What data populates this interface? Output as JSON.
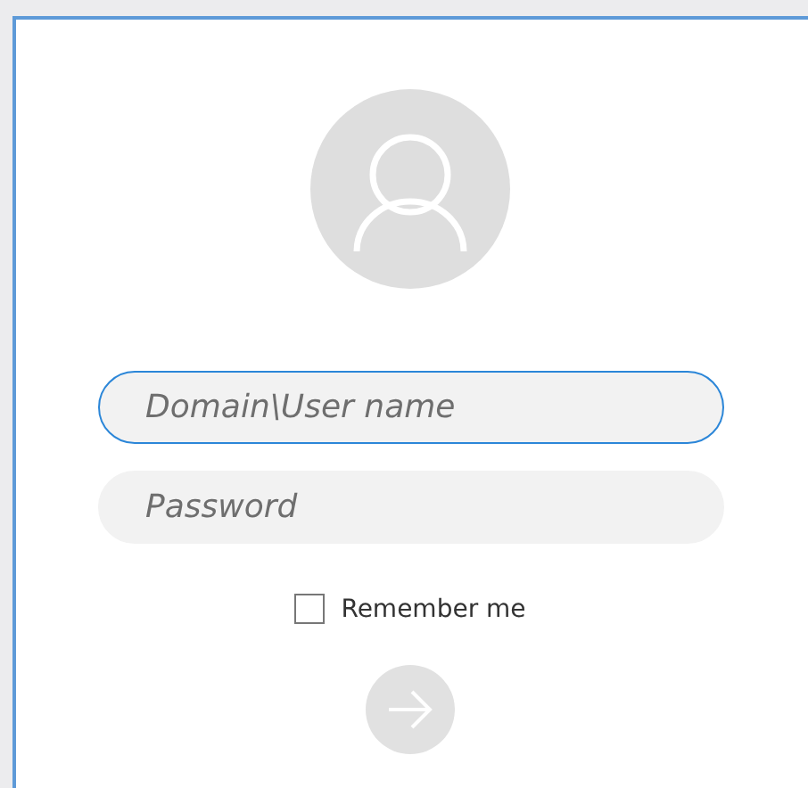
{
  "username": {
    "placeholder": "Domain\\User name",
    "focused": true
  },
  "password": {
    "placeholder": "Password",
    "focused": false
  },
  "remember": {
    "label": "Remember me",
    "checked": false
  },
  "sign_in": {
    "disabled": true
  }
}
